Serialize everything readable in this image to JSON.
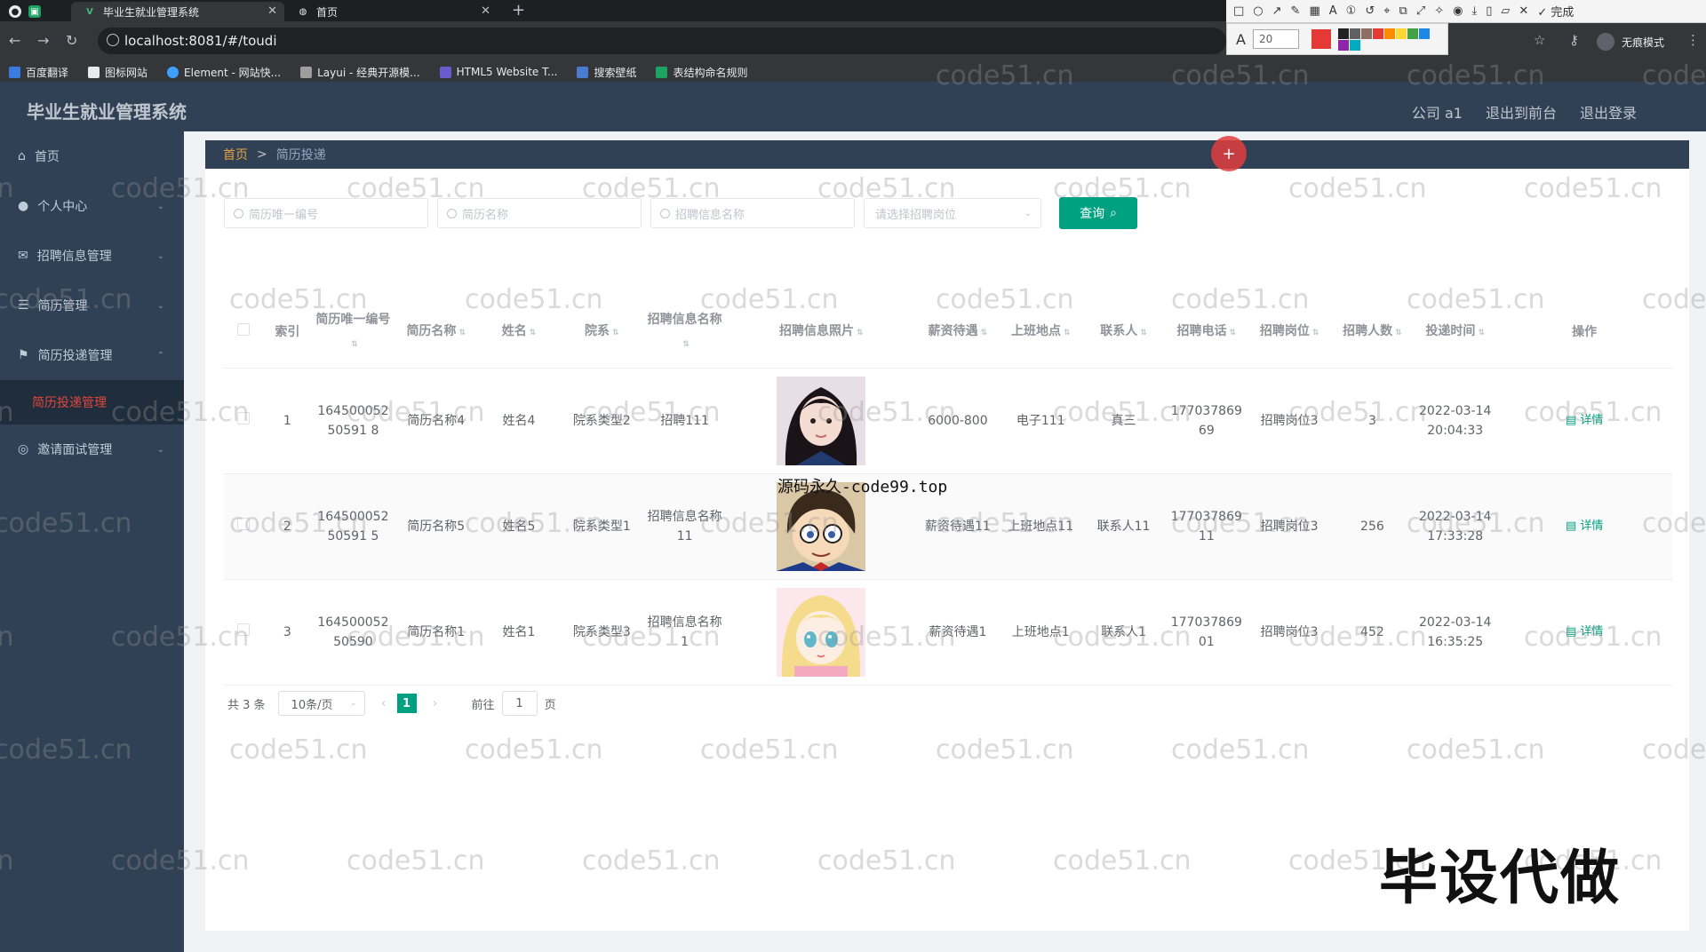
{
  "browser": {
    "tabs": [
      {
        "label": "毕业生就业管理系统",
        "active": true
      },
      {
        "label": "首页",
        "active": false
      }
    ],
    "url": "localhost:8081/#/toudi",
    "bookmarks": [
      "百度翻译",
      "图标网站",
      "Element - 网站快...",
      "Layui - 经典开源模...",
      "HTML5 Website T...",
      "搜索壁纸",
      "表结构命名规则"
    ],
    "incognito": "无痕模式",
    "annot_size": "20",
    "annot_done": "完成",
    "colors": [
      "#e53935",
      "#212121",
      "#616161",
      "#8d6e63",
      "#e53935",
      "#fb8c00",
      "#fdd835",
      "#43a047",
      "#1e88e5",
      "#8e24aa",
      "#00acc1"
    ]
  },
  "app": {
    "title": "毕业生就业管理系统",
    "header_links": [
      "公司 a1",
      "退出到前台",
      "退出登录"
    ],
    "accent": "#00a181",
    "sidebar_bg": "#304156"
  },
  "sidebar": {
    "items": [
      {
        "label": "首页",
        "icon": "home-icon",
        "chevron": ""
      },
      {
        "label": "个人中心",
        "icon": "user-icon",
        "chevron": "⌄"
      },
      {
        "label": "招聘信息管理",
        "icon": "mail-icon",
        "chevron": "⌄"
      },
      {
        "label": "简历管理",
        "icon": "sliders-icon",
        "chevron": "⌄"
      },
      {
        "label": "简历投递管理",
        "icon": "flag-icon",
        "chevron": "⌃"
      },
      {
        "label": "邀请面试管理",
        "icon": "target-icon",
        "chevron": "⌄"
      }
    ],
    "active_sub": "简历投递管理"
  },
  "breadcrumb": {
    "home": "首页",
    "sep": ">",
    "current": "简历投递"
  },
  "search": {
    "placeholders": [
      "简历唯一编号",
      "简历名称",
      "招聘信息名称"
    ],
    "select_placeholder": "请选择招聘岗位",
    "query_label": "查询"
  },
  "table": {
    "columns": [
      "索引",
      "简历唯一编号",
      "简历名称",
      "姓名",
      "院系",
      "招聘信息名称",
      "招聘信息照片",
      "薪资待遇",
      "上班地点",
      "联系人",
      "招聘电话",
      "招聘岗位",
      "招聘人数",
      "投递时间",
      "操作"
    ],
    "rows": [
      {
        "index": "1",
        "code": "16450005250591 8",
        "resume": "简历名称4",
        "name": "姓名4",
        "dept": "院系类型2",
        "job": "招聘111",
        "salary": "6000-800",
        "place": "电子111",
        "contact": "真三",
        "phone": "17703786969",
        "post": "招聘岗位3",
        "count": "3",
        "time": "2022-03-14 20:04:33",
        "action": "详情",
        "photo": "girl-photo"
      },
      {
        "index": "2",
        "code": "16450005250591 5",
        "resume": "简历名称5",
        "name": "姓名5",
        "dept": "院系类型1",
        "job": "招聘信息名称11",
        "salary": "薪资待遇11",
        "place": "上班地点11",
        "contact": "联系人11",
        "phone": "17703786911",
        "post": "招聘岗位3",
        "count": "256",
        "time": "2022-03-14 17:33:28",
        "action": "详情",
        "photo": "anime-boy-photo"
      },
      {
        "index": "3",
        "code": "16450005250590",
        "resume": "简历名称1",
        "name": "姓名1",
        "dept": "院系类型3",
        "job": "招聘信息名称1",
        "salary": "薪资待遇1",
        "place": "上班地点1",
        "contact": "联系人1",
        "phone": "17703786901",
        "post": "招聘岗位3",
        "count": "452",
        "time": "2022-03-14 16:35:25",
        "action": "详情",
        "photo": "anime-girl-photo"
      }
    ]
  },
  "pager": {
    "total": "共 3 条",
    "size": "10条/页",
    "current": "1",
    "goto_prefix": "前往",
    "goto_value": "1",
    "goto_suffix": "页"
  },
  "overlays": {
    "watermark": "code51.cn",
    "source_text": "源码永久-code99.top",
    "ad_text": "毕设代做"
  }
}
